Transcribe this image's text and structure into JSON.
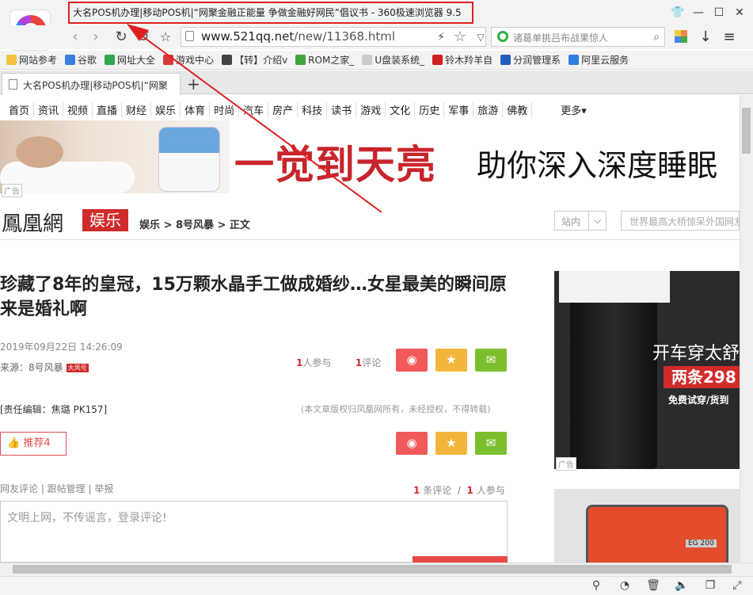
{
  "window": {
    "title": "大名POS机办理|移动POS机|“网聚金融正能量 争做金融好网民”倡议书 - 360极速浏览器 9.5"
  },
  "toolbar": {
    "url_host": "www.521qq.net",
    "url_path": "/new/11368.html",
    "search_placeholder": "诸葛单挑吕布战果惊人"
  },
  "bookmarks": [
    {
      "label": "网站参考",
      "color": "#f5c342"
    },
    {
      "label": "谷歌",
      "color": "#3b7de0"
    },
    {
      "label": "网址大全",
      "color": "#2fa84f"
    },
    {
      "label": "游戏中心",
      "color": "#d83a3a"
    },
    {
      "label": "【转】介绍v",
      "color": "#444444"
    },
    {
      "label": "ROM之家_",
      "color": "#3fa33f"
    },
    {
      "label": "U盘装系统_",
      "color": "#cccccc"
    },
    {
      "label": "铃木羚羊自",
      "color": "#d02020"
    },
    {
      "label": "分润管理系",
      "color": "#2060c0"
    },
    {
      "label": "阿里云服务",
      "color": "#2f7fe0"
    }
  ],
  "tab": {
    "label": "大名POS机办理|移动POS机|“网聚"
  },
  "channels": [
    "首页",
    "资讯",
    "视频",
    "直播",
    "财经",
    "娱乐",
    "体育",
    "时尚",
    "汽车",
    "房产",
    "科技",
    "读书",
    "游戏",
    "文化",
    "历史",
    "军事",
    "旅游",
    "佛教"
  ],
  "channels_more": "更多▾",
  "banner": {
    "headline": "一觉到天亮",
    "subline": "助你深入深度睡眠",
    "ad_label": "广告"
  },
  "header": {
    "brand": "鳳凰網",
    "brand_section": "娱乐",
    "breadcrumb": "娱乐 > 8号风暴 > 正文",
    "site_select": "站内",
    "search_placeholder": "世界最高大桥惊呆外国网友"
  },
  "article": {
    "title": "珍藏了8年的皇冠，15万颗水晶手工做成婚纱…女星最美的瞬间原来是婚礼啊",
    "date": "2019年09月22日 14:26:09",
    "source": "来源：8号风暴",
    "source_tag": "大风号",
    "participants_count": "1",
    "participants_label": "人参与",
    "comments_count": "1",
    "comments_label": "评论",
    "editor": "[责任编辑：焦璐 PK157]",
    "copyright": "(本文章版权归凤凰网所有，未经授权，不得转载)",
    "recommend": "推荐4"
  },
  "comments": {
    "links": "网友评论 | 跟帖管理 | 举报",
    "count": "1",
    "count_label": "条评论",
    "sep": "/",
    "people": "1",
    "people_label": "人参与",
    "placeholder": "文明上网，不传谣言，登录评论!"
  },
  "side_ads": {
    "ad1_title": "开车穿太舒",
    "ad1_promo": "两条298",
    "ad1_sub": "免费试穿/货到",
    "ad_label": "广告",
    "ad2_label": "EG 200"
  },
  "accent": {
    "red": "#d02b2b",
    "weibo": "#f05a5a",
    "fav": "#f4b63a",
    "wechat": "#7cbf2e"
  }
}
